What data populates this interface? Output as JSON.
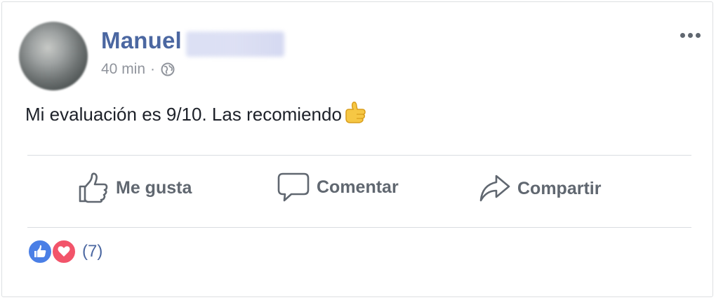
{
  "post": {
    "author_name": "Manuel",
    "time": "40 min",
    "separator": "·",
    "privacy_icon": "globe-icon",
    "text": "Mi evaluación es 9/10. Las recomiendo",
    "emoji": "thumbs-up-pointing-right"
  },
  "actions": {
    "like_label": "Me gusta",
    "comment_label": "Comentar",
    "share_label": "Compartir"
  },
  "reactions": {
    "types": [
      "like",
      "love"
    ],
    "count_text": "(7)"
  },
  "colors": {
    "author": "#4b67a1",
    "like_reaction": "#4a7fe6",
    "love_reaction": "#f2546a",
    "action_text": "#606770"
  }
}
